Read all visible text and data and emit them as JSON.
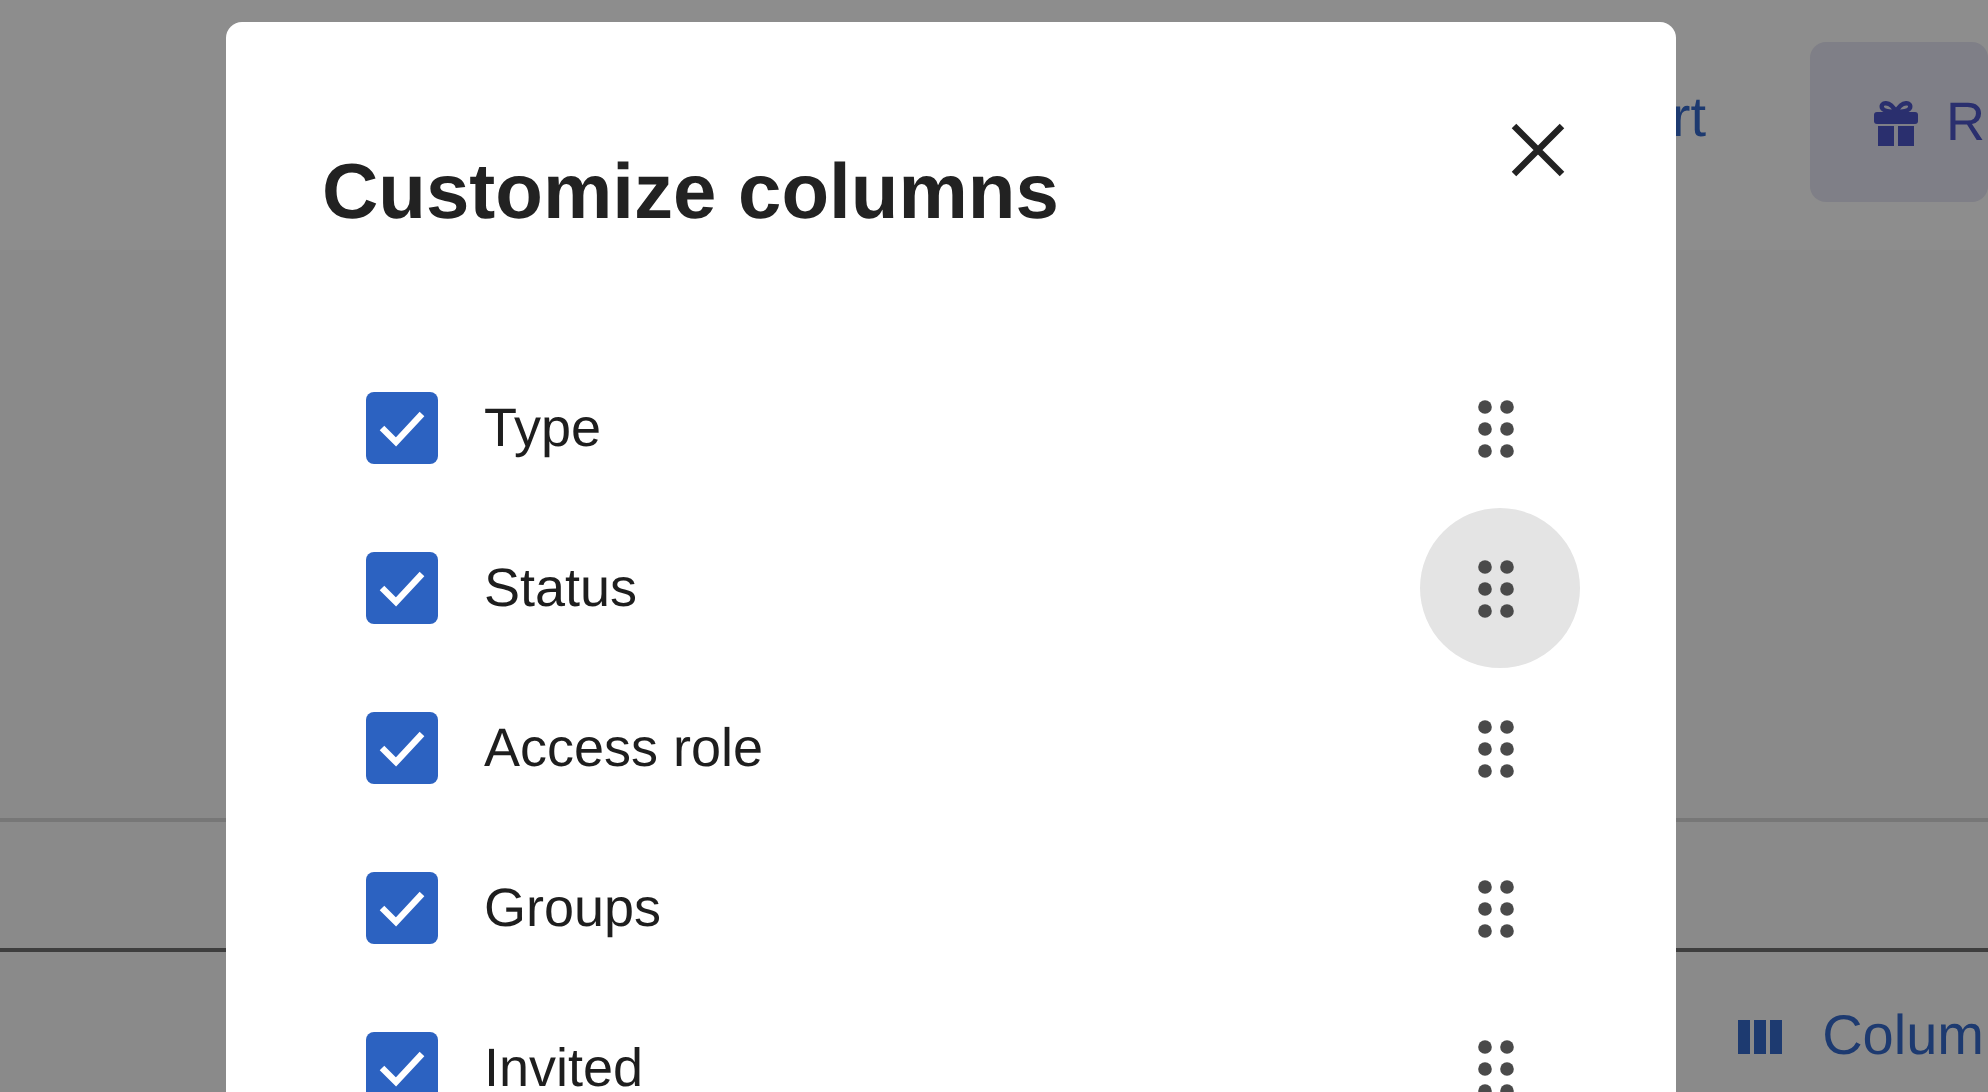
{
  "page": {
    "header_link": "rt",
    "header_button": "R",
    "columns_button": "Colum"
  },
  "dialog": {
    "title": "Customize columns",
    "columns": [
      {
        "label": "Type",
        "checked": true,
        "handle_hovered": false
      },
      {
        "label": "Status",
        "checked": true,
        "handle_hovered": true
      },
      {
        "label": "Access role",
        "checked": true,
        "handle_hovered": false
      },
      {
        "label": "Groups",
        "checked": true,
        "handle_hovered": false
      },
      {
        "label": "Invited",
        "checked": true,
        "handle_hovered": false
      }
    ]
  }
}
